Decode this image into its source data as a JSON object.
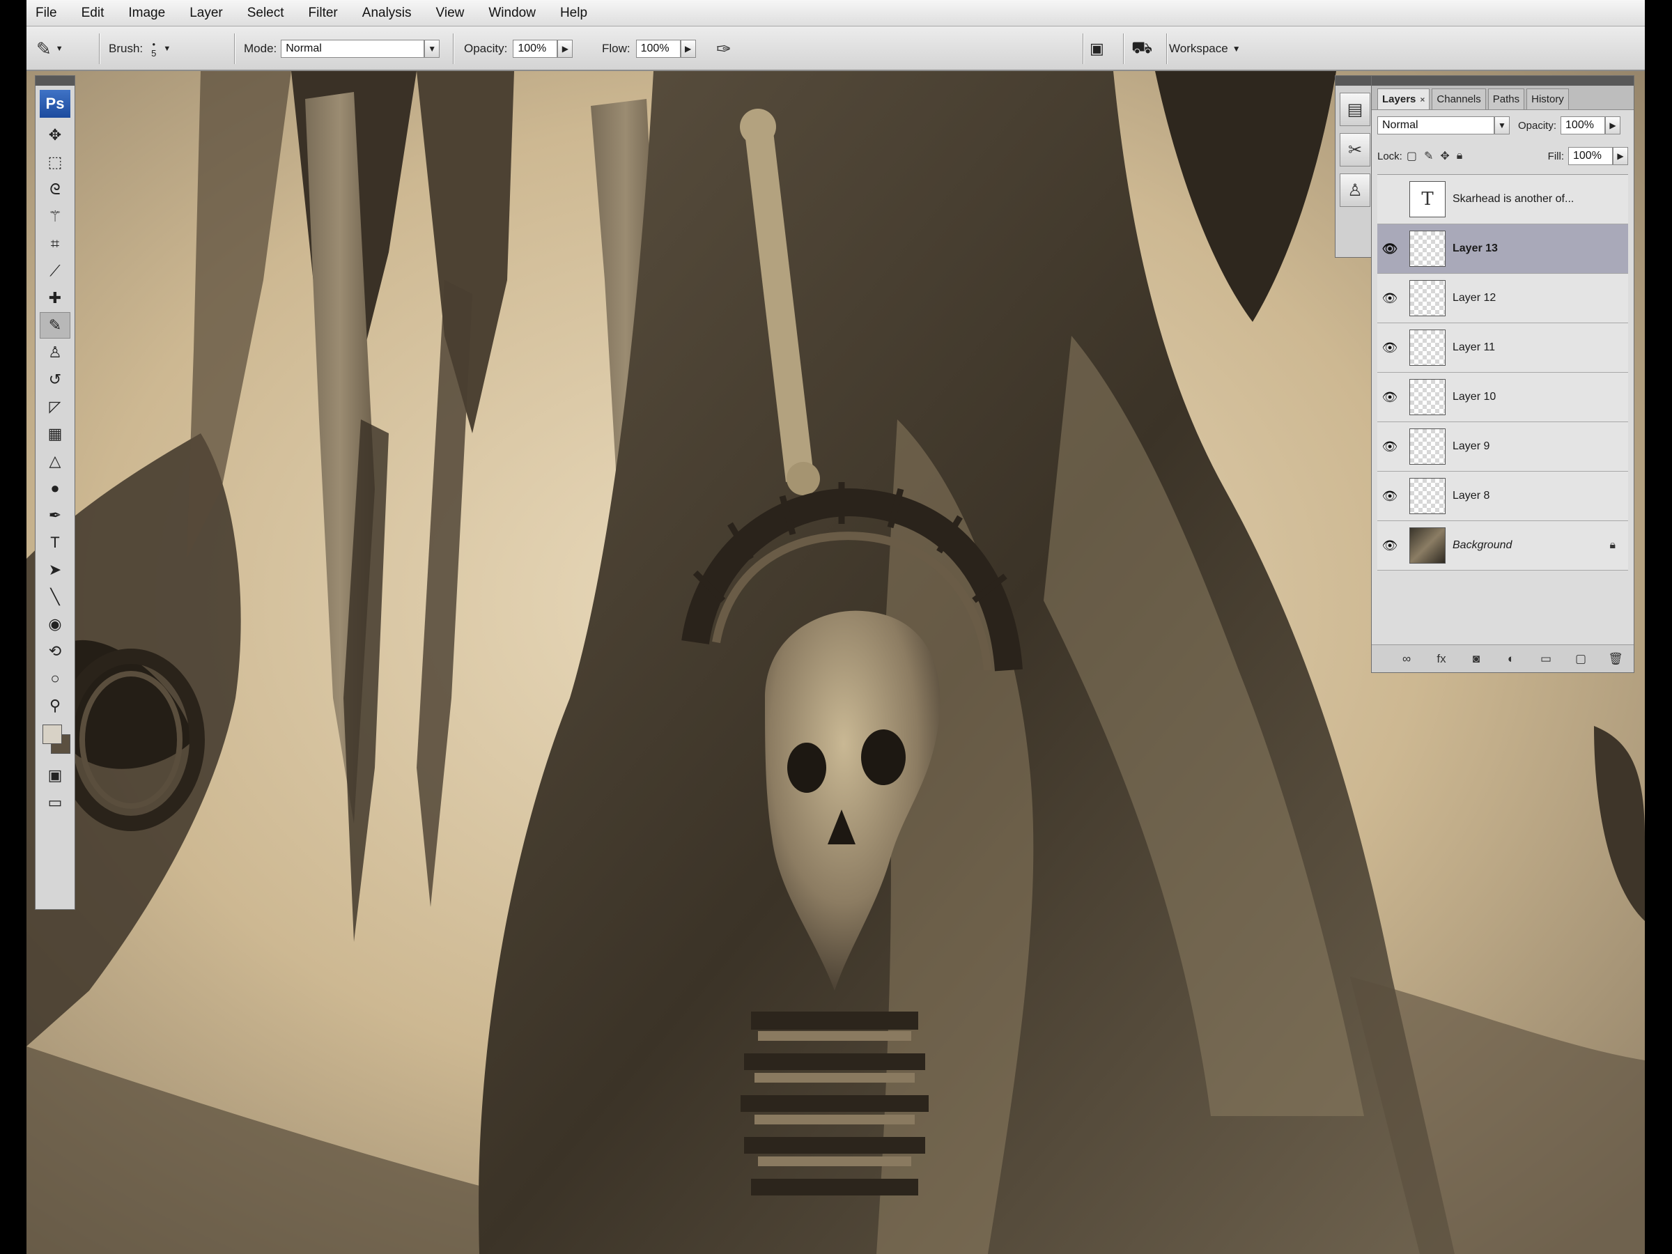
{
  "menu": [
    "File",
    "Edit",
    "Image",
    "Layer",
    "Select",
    "Filter",
    "Analysis",
    "View",
    "Window",
    "Help"
  ],
  "options": {
    "brush_label": "Brush:",
    "brush_size": "5",
    "mode_label": "Mode:",
    "mode_value": "Normal",
    "opacity_label": "Opacity:",
    "opacity_value": "100%",
    "flow_label": "Flow:",
    "flow_value": "100%",
    "workspace_label": "Workspace"
  },
  "tools_panel": {
    "logo": "Ps",
    "tools": [
      {
        "name": "move-tool",
        "glyph": "✥"
      },
      {
        "name": "marquee-tool",
        "glyph": "⬚"
      },
      {
        "name": "lasso-tool",
        "glyph": "ᘓ"
      },
      {
        "name": "magic-wand-tool",
        "glyph": "⚚"
      },
      {
        "name": "crop-tool",
        "glyph": "⌗"
      },
      {
        "name": "eyedropper-tool",
        "glyph": "⟋"
      },
      {
        "name": "healing-brush-tool",
        "glyph": "✚"
      },
      {
        "name": "brush-tool",
        "glyph": "✎",
        "active": true
      },
      {
        "name": "clone-stamp-tool",
        "glyph": "♙"
      },
      {
        "name": "history-brush-tool",
        "glyph": "↺"
      },
      {
        "name": "eraser-tool",
        "glyph": "◸"
      },
      {
        "name": "gradient-tool",
        "glyph": "▦"
      },
      {
        "name": "blur-tool",
        "glyph": "△"
      },
      {
        "name": "dodge-tool",
        "glyph": "●"
      },
      {
        "name": "pen-tool",
        "glyph": "✒"
      },
      {
        "name": "type-tool",
        "glyph": "T"
      },
      {
        "name": "path-selection-tool",
        "glyph": "➤"
      },
      {
        "name": "line-tool",
        "glyph": "╲"
      },
      {
        "name": "3d-rotate-tool",
        "glyph": "◉"
      },
      {
        "name": "3d-camera-tool",
        "glyph": "⟲"
      },
      {
        "name": "hand-tool",
        "glyph": "○"
      },
      {
        "name": "zoom-tool",
        "glyph": "⚲"
      }
    ],
    "quick_mask_glyph": "▣",
    "screen_mode_glyph": "▭"
  },
  "layers_panel": {
    "tabs": [
      "Layers",
      "Channels",
      "Paths",
      "History"
    ],
    "blend_mode": "Normal",
    "opacity_label": "Opacity:",
    "opacity_value": "100%",
    "lock_label": "Lock:",
    "fill_label": "Fill:",
    "fill_value": "100%",
    "layers": [
      {
        "name": "Skarhead is another of...",
        "visible": false,
        "type": "text"
      },
      {
        "name": "Layer 13",
        "visible": true,
        "type": "pixel",
        "selected": true
      },
      {
        "name": "Layer 12",
        "visible": true,
        "type": "pixel"
      },
      {
        "name": "Layer 11",
        "visible": true,
        "type": "pixel"
      },
      {
        "name": "Layer 10",
        "visible": true,
        "type": "pixel"
      },
      {
        "name": "Layer 9",
        "visible": true,
        "type": "pixel"
      },
      {
        "name": "Layer 8",
        "visible": true,
        "type": "pixel"
      },
      {
        "name": "Background",
        "visible": true,
        "type": "background",
        "locked": true
      }
    ],
    "bottom_icons": [
      "link-icon",
      "fx-icon",
      "mask-icon",
      "adjustment-icon",
      "group-icon",
      "new-layer-icon",
      "trash-icon"
    ]
  },
  "colors": {
    "parchment": "#d9c7a6",
    "sepia_dark": "#2b241b",
    "sepia_mid": "#6b5c47",
    "selection": "#a9a9b9"
  }
}
